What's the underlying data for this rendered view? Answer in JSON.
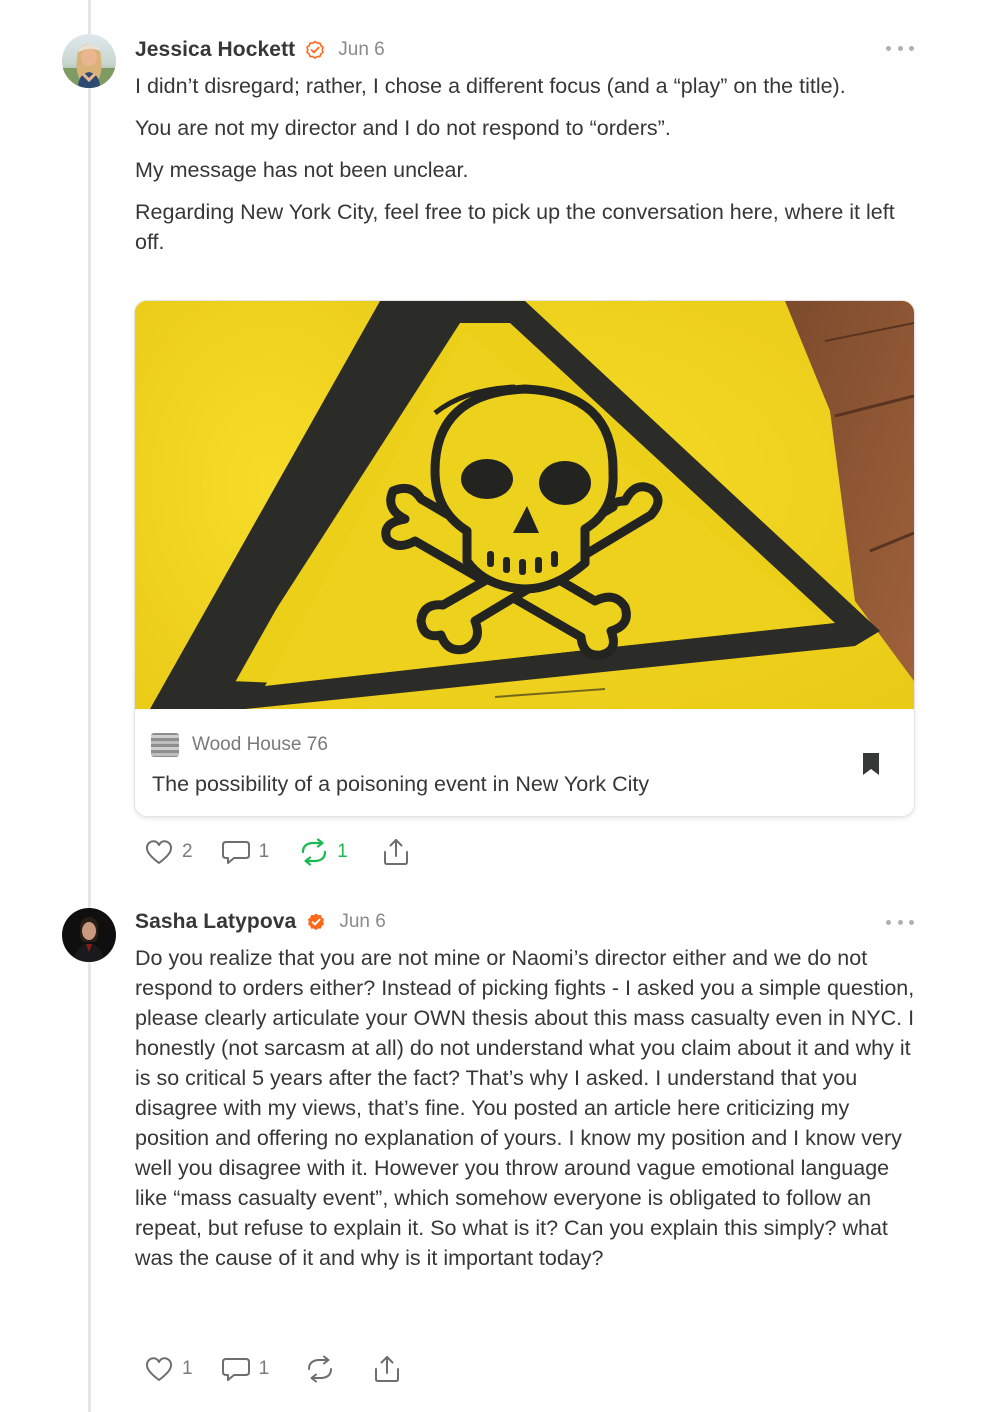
{
  "colors": {
    "accent": "#ff6719",
    "restack_active": "#1db954",
    "text": "#363737",
    "muted": "#8a8a8a",
    "warning_yellow": "#f3d51d"
  },
  "comments": [
    {
      "author": "Jessica Hockett",
      "badge_icon": "verified-outline-icon",
      "date": "Jun 6",
      "paragraphs": [
        "I didn’t disregard; rather, I chose a different focus (and a “play” on the title).",
        "You are not my director and I do not respond to “orders”.",
        "My message has not been unclear.",
        "Regarding New York City, feel free to pick up the conversation here, where it left off."
      ],
      "embed": {
        "image_icon": "skull-crossbones-warning-sign",
        "publication": "Wood House 76",
        "title": "The possibility of a poisoning event in New York City",
        "bookmark_icon": "bookmark-icon"
      },
      "actions": {
        "likes": "2",
        "replies": "1",
        "restacks": "1"
      }
    },
    {
      "author": "Sasha Latypova",
      "badge_icon": "verified-filled-icon",
      "date": "Jun 6",
      "paragraphs": [
        "Do you realize that you are not mine or Naomi’s director either and we do not respond to orders either? Instead of picking fights - I asked you a simple question, please clearly articulate your OWN thesis about this mass casualty even in NYC. I honestly (not sarcasm at all) do not understand what you claim about it and why it is so critical 5 years after the fact? That’s why I asked. I understand that you disagree with my views, that’s fine. You posted an article here criticizing my position and offering no explanation of yours. I know my position and I know very well you disagree with it. However you throw around vague emotional language like “mass casualty event”, which somehow everyone is obligated to follow an repeat, but refuse to explain it. So what is it? Can you explain this simply? what was the cause of it and why is it important today?"
      ],
      "actions": {
        "likes": "1",
        "replies": "1"
      }
    }
  ]
}
